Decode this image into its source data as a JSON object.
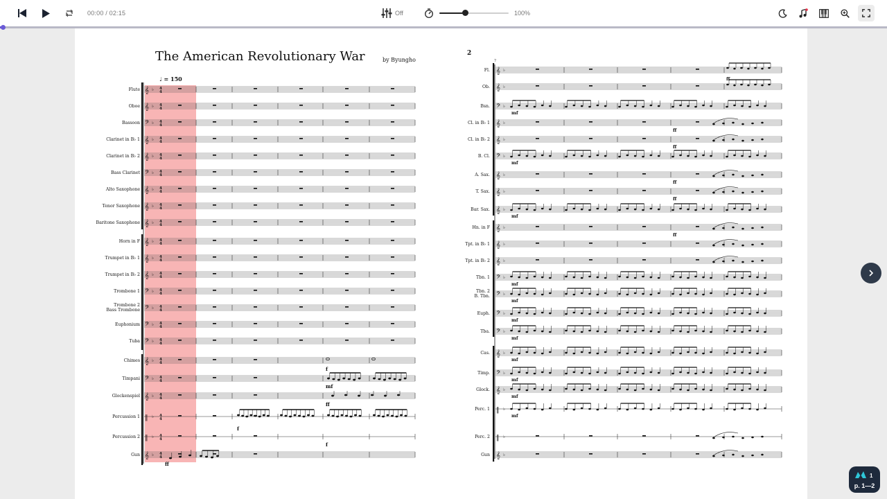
{
  "toolbar": {
    "time": "00:00 / 02:15",
    "mixer_label": "Off",
    "tempo_value": "100%",
    "tempo_fraction": 0.37,
    "playback_progress": 0.003
  },
  "score": {
    "title": "The American Revolutionary War",
    "composer": "by Byungho",
    "tempo_mark": "♩ = 150",
    "page2_number": "2",
    "page1_instruments": [
      "Flute",
      "Oboe",
      "Bassoon",
      "Clarinet in B♭ 1",
      "Clarinet in B♭ 2",
      "Bass Clarinet",
      "Alto Saxophone",
      "Tenor Saxophone",
      "Baritone Saxophone",
      "Horn in F",
      "Trumpet in B♭ 1",
      "Trumpet in B♭ 2",
      "Trombone 1",
      "Trombone 2\nBass Trombone",
      "Euphonium",
      "Tuba",
      "Chimes",
      "Timpani",
      "Glockenspiel",
      "Percussion 1",
      "Percussion 2",
      "Gun"
    ],
    "page2_instruments": [
      "Fl.",
      "Ob.",
      "Bsn.",
      "Cl. in B♭ 1",
      "Cl. in B♭ 2",
      "B. Cl.",
      "A. Sax.",
      "T. Sax.",
      "Bar. Sax.",
      "Hn. in F",
      "Tpt. in B♭ 1",
      "Tpt. in B♭ 2",
      "Tbn. 1",
      "Tbn. 2\nB. Tbn.",
      "Euph.",
      "Tba.",
      "Cas.",
      "Timp.",
      "Glock.",
      "Perc. 1",
      "Perc. 2",
      "Gun"
    ]
  },
  "navigation": {
    "page_indicator": "p. 1—2",
    "badge_count": "1"
  },
  "colors": {
    "accent": "#6a5bd6",
    "playhead": "#f7a8a8",
    "badge_bg": "#1e2a3c"
  },
  "icons": [
    "skip-back-icon",
    "play-icon",
    "loop-icon",
    "mixer-icon",
    "metronome-icon",
    "moon-icon",
    "music-note-icon",
    "piano-icon",
    "zoom-icon",
    "fullscreen-icon",
    "chevron-right-icon",
    "musescore-icon"
  ]
}
